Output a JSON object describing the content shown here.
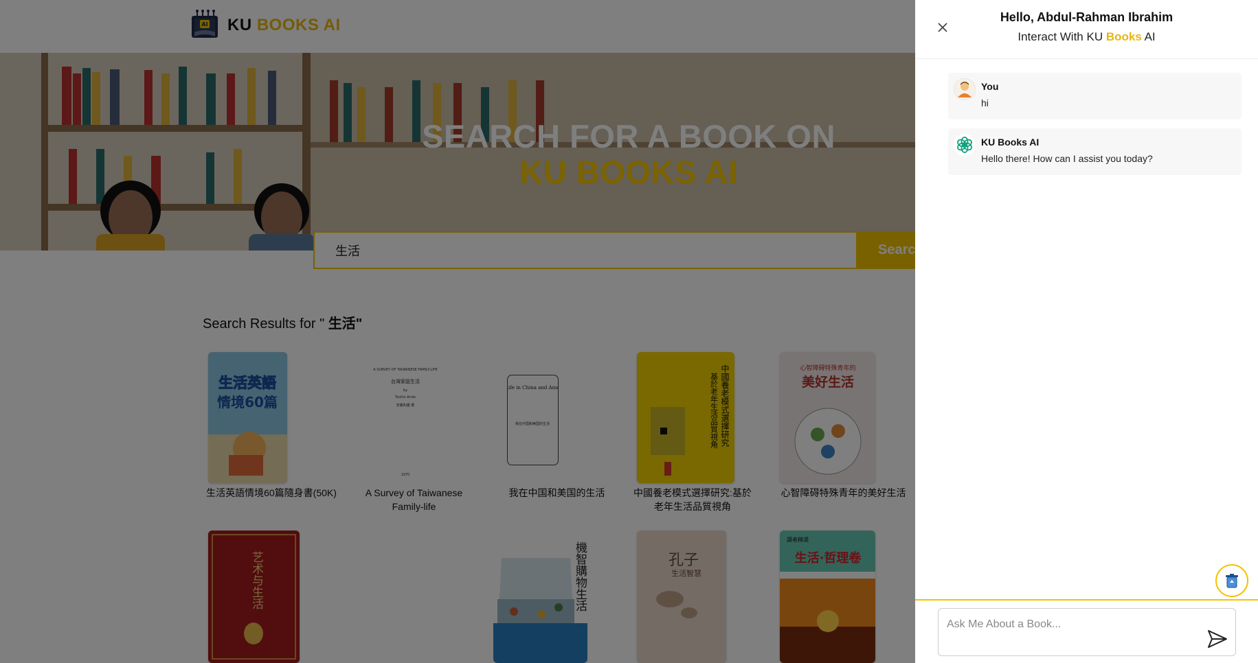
{
  "header": {
    "logo_ku": "KU",
    "logo_books": "BOOKS AI"
  },
  "hero": {
    "title_line1": "SEARCH FOR A BOOK ON",
    "title_line2": "KU BOOKS AI"
  },
  "search": {
    "value": "生活",
    "button_label": "Search"
  },
  "results": {
    "heading_prefix": "Search Results for \" ",
    "heading_query": "生活\"",
    "books": [
      {
        "title": "生活英語情境60篇隨身書(50K)"
      },
      {
        "title": "A Survey of Taiwanese Family-life"
      },
      {
        "title": "我在中国和美国的生活"
      },
      {
        "title": "中國養老模式選擇研究:基於老年生活品質視角"
      },
      {
        "title": "心智障碍特殊青年的美好生活"
      },
      {
        "title": ""
      },
      {
        "title": ""
      },
      {
        "title": ""
      },
      {
        "title": ""
      }
    ],
    "cover_texts": {
      "c1_top": "生活英語",
      "c1_bottom": "情境60篇",
      "c2_line1": "A SURVEY OF TAIWANESE FAMILY-LIFE",
      "c2_line2": "台灣家庭生活",
      "c2_by": "by",
      "c2_author": "Toshio Ando",
      "c2_author_cn": "安藤利雄 著",
      "c2_year": "1970",
      "c3_title": "My Life in China and America",
      "c3_cn": "我在中国和美国的生活",
      "c4_title": "中國養老模式選擇研究",
      "c4_sub": "基於老年生活品質視角",
      "c5_sub": "心智障碍特殊青年的",
      "c5_title": "美好生活",
      "c6_title": "艺术与生活",
      "c7_title": "機智購物生活",
      "c8_title": "孔子",
      "c8_sub": "生活智慧",
      "c9_pub": "讀者精選",
      "c9_title": "生活·哲理卷"
    }
  },
  "chat": {
    "greeting": "Hello, Abdul-Rahman Ibrahim",
    "sub_prefix": "Interact With KU ",
    "sub_books": "Books",
    "sub_suffix": " AI",
    "messages": [
      {
        "sender": "You",
        "text": "hi"
      },
      {
        "sender": "KU Books AI",
        "text": "Hello there! How can I assist you today?"
      }
    ],
    "input_placeholder": "Ask Me About a Book..."
  },
  "colors": {
    "accent": "#F4C300",
    "brand_yellow": "#E8B611",
    "overlay": "rgba(0,0,0,0.5)"
  },
  "icons": {
    "close": "close-icon",
    "send": "send-icon",
    "clear": "recycle-bin-icon",
    "user_avatar": "user-avatar-icon",
    "ai_avatar": "openai-logo-icon"
  }
}
